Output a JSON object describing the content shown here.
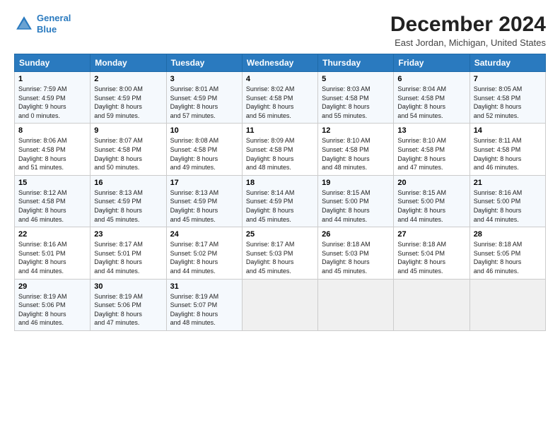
{
  "header": {
    "logo_line1": "General",
    "logo_line2": "Blue",
    "title": "December 2024",
    "subtitle": "East Jordan, Michigan, United States"
  },
  "days_of_week": [
    "Sunday",
    "Monday",
    "Tuesday",
    "Wednesday",
    "Thursday",
    "Friday",
    "Saturday"
  ],
  "weeks": [
    [
      {
        "day": "1",
        "info": "Sunrise: 7:59 AM\nSunset: 4:59 PM\nDaylight: 9 hours\nand 0 minutes."
      },
      {
        "day": "2",
        "info": "Sunrise: 8:00 AM\nSunset: 4:59 PM\nDaylight: 8 hours\nand 59 minutes."
      },
      {
        "day": "3",
        "info": "Sunrise: 8:01 AM\nSunset: 4:59 PM\nDaylight: 8 hours\nand 57 minutes."
      },
      {
        "day": "4",
        "info": "Sunrise: 8:02 AM\nSunset: 4:58 PM\nDaylight: 8 hours\nand 56 minutes."
      },
      {
        "day": "5",
        "info": "Sunrise: 8:03 AM\nSunset: 4:58 PM\nDaylight: 8 hours\nand 55 minutes."
      },
      {
        "day": "6",
        "info": "Sunrise: 8:04 AM\nSunset: 4:58 PM\nDaylight: 8 hours\nand 54 minutes."
      },
      {
        "day": "7",
        "info": "Sunrise: 8:05 AM\nSunset: 4:58 PM\nDaylight: 8 hours\nand 52 minutes."
      }
    ],
    [
      {
        "day": "8",
        "info": "Sunrise: 8:06 AM\nSunset: 4:58 PM\nDaylight: 8 hours\nand 51 minutes."
      },
      {
        "day": "9",
        "info": "Sunrise: 8:07 AM\nSunset: 4:58 PM\nDaylight: 8 hours\nand 50 minutes."
      },
      {
        "day": "10",
        "info": "Sunrise: 8:08 AM\nSunset: 4:58 PM\nDaylight: 8 hours\nand 49 minutes."
      },
      {
        "day": "11",
        "info": "Sunrise: 8:09 AM\nSunset: 4:58 PM\nDaylight: 8 hours\nand 48 minutes."
      },
      {
        "day": "12",
        "info": "Sunrise: 8:10 AM\nSunset: 4:58 PM\nDaylight: 8 hours\nand 48 minutes."
      },
      {
        "day": "13",
        "info": "Sunrise: 8:10 AM\nSunset: 4:58 PM\nDaylight: 8 hours\nand 47 minutes."
      },
      {
        "day": "14",
        "info": "Sunrise: 8:11 AM\nSunset: 4:58 PM\nDaylight: 8 hours\nand 46 minutes."
      }
    ],
    [
      {
        "day": "15",
        "info": "Sunrise: 8:12 AM\nSunset: 4:58 PM\nDaylight: 8 hours\nand 46 minutes."
      },
      {
        "day": "16",
        "info": "Sunrise: 8:13 AM\nSunset: 4:59 PM\nDaylight: 8 hours\nand 45 minutes."
      },
      {
        "day": "17",
        "info": "Sunrise: 8:13 AM\nSunset: 4:59 PM\nDaylight: 8 hours\nand 45 minutes."
      },
      {
        "day": "18",
        "info": "Sunrise: 8:14 AM\nSunset: 4:59 PM\nDaylight: 8 hours\nand 45 minutes."
      },
      {
        "day": "19",
        "info": "Sunrise: 8:15 AM\nSunset: 5:00 PM\nDaylight: 8 hours\nand 44 minutes."
      },
      {
        "day": "20",
        "info": "Sunrise: 8:15 AM\nSunset: 5:00 PM\nDaylight: 8 hours\nand 44 minutes."
      },
      {
        "day": "21",
        "info": "Sunrise: 8:16 AM\nSunset: 5:00 PM\nDaylight: 8 hours\nand 44 minutes."
      }
    ],
    [
      {
        "day": "22",
        "info": "Sunrise: 8:16 AM\nSunset: 5:01 PM\nDaylight: 8 hours\nand 44 minutes."
      },
      {
        "day": "23",
        "info": "Sunrise: 8:17 AM\nSunset: 5:01 PM\nDaylight: 8 hours\nand 44 minutes."
      },
      {
        "day": "24",
        "info": "Sunrise: 8:17 AM\nSunset: 5:02 PM\nDaylight: 8 hours\nand 44 minutes."
      },
      {
        "day": "25",
        "info": "Sunrise: 8:17 AM\nSunset: 5:03 PM\nDaylight: 8 hours\nand 45 minutes."
      },
      {
        "day": "26",
        "info": "Sunrise: 8:18 AM\nSunset: 5:03 PM\nDaylight: 8 hours\nand 45 minutes."
      },
      {
        "day": "27",
        "info": "Sunrise: 8:18 AM\nSunset: 5:04 PM\nDaylight: 8 hours\nand 45 minutes."
      },
      {
        "day": "28",
        "info": "Sunrise: 8:18 AM\nSunset: 5:05 PM\nDaylight: 8 hours\nand 46 minutes."
      }
    ],
    [
      {
        "day": "29",
        "info": "Sunrise: 8:19 AM\nSunset: 5:06 PM\nDaylight: 8 hours\nand 46 minutes."
      },
      {
        "day": "30",
        "info": "Sunrise: 8:19 AM\nSunset: 5:06 PM\nDaylight: 8 hours\nand 47 minutes."
      },
      {
        "day": "31",
        "info": "Sunrise: 8:19 AM\nSunset: 5:07 PM\nDaylight: 8 hours\nand 48 minutes."
      },
      {
        "day": "",
        "info": ""
      },
      {
        "day": "",
        "info": ""
      },
      {
        "day": "",
        "info": ""
      },
      {
        "day": "",
        "info": ""
      }
    ]
  ]
}
